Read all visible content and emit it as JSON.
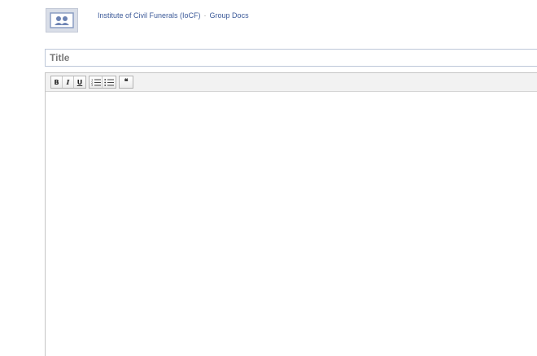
{
  "header": {
    "group_name": "Institute of Civil Funerals (IoCF)",
    "separator": "·",
    "section": "Group Docs"
  },
  "title_field": {
    "placeholder": "Title",
    "value": ""
  },
  "toolbar": {
    "bold_label": "B",
    "italic_label": "I",
    "underline_label": "U",
    "numbered_list_icon": "numbered-list-icon",
    "bulleted_list_icon": "bulleted-list-icon",
    "quote_label": "❝"
  },
  "editor": {
    "body": ""
  },
  "colors": {
    "link": "#3b5998",
    "toolbar_bg": "#f2f2f2",
    "border": "#bdc7d8"
  }
}
